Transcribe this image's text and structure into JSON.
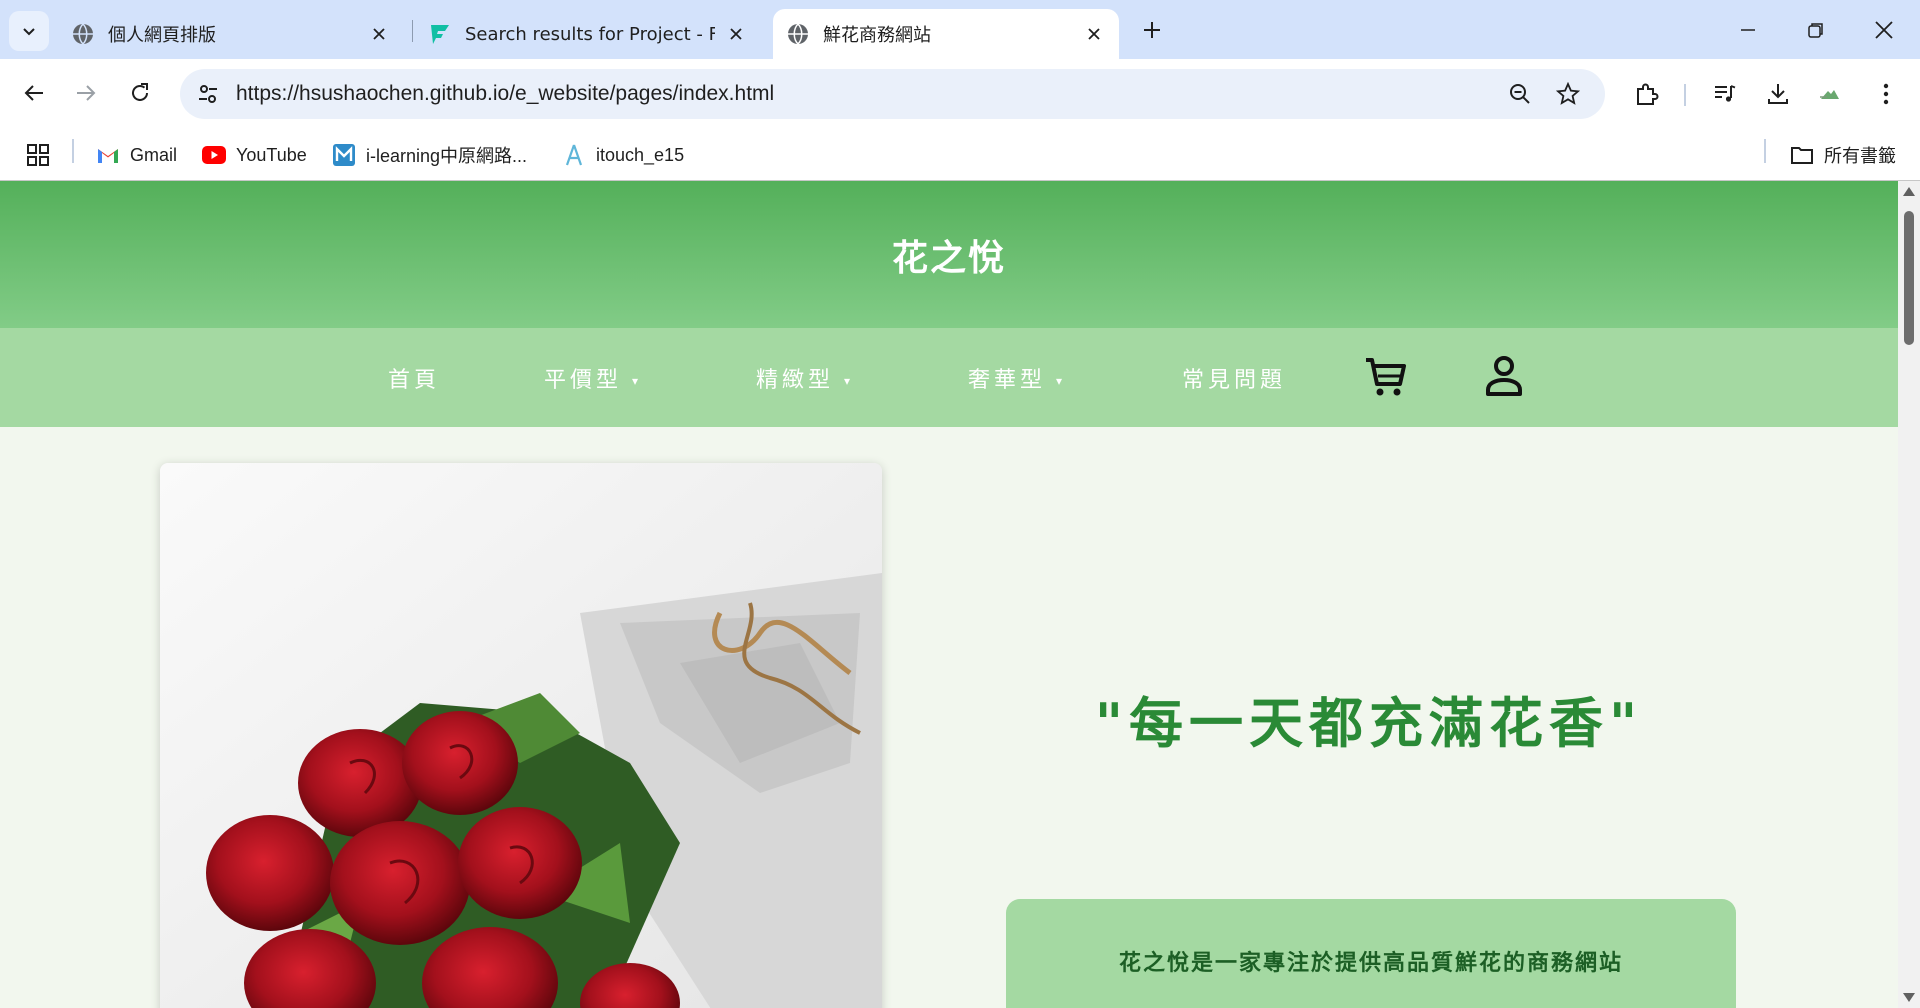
{
  "browser": {
    "tabs": [
      {
        "title": "個人網頁排版",
        "active": false
      },
      {
        "title": "Search results for Project - Fla",
        "active": false
      },
      {
        "title": "鮮花商務網站",
        "active": true
      }
    ],
    "url": "https://hsushaochen.github.io/e_website/pages/index.html",
    "bookmarks": [
      {
        "label": "Gmail"
      },
      {
        "label": "YouTube"
      },
      {
        "label": "i-learning中原網路..."
      },
      {
        "label": "itouch_e15"
      }
    ],
    "all_bookmarks_label": "所有書籤"
  },
  "site": {
    "title": "花之悅",
    "nav": [
      {
        "label": "首頁"
      },
      {
        "label": "平價型",
        "dropdown": true
      },
      {
        "label": "精緻型",
        "dropdown": true
      },
      {
        "label": "奢華型",
        "dropdown": true
      },
      {
        "label": "常見問題"
      }
    ],
    "caret": "▾",
    "cart_icon": "cart-icon",
    "account_icon": "user-icon",
    "hero_image": "red-roses-bouquet-photo",
    "slogan": "\"每一天都充滿花香\"",
    "about_text": "花之悅是一家專注於提供高品質鮮花的商務網站"
  },
  "colors": {
    "header_top": "#54b05a",
    "header_bottom": "#82cc87",
    "nav_bg": "#a4d9a2",
    "page_bg": "#f2f7ee",
    "slogan": "#2a8a36",
    "about_text": "#1c5f25"
  }
}
